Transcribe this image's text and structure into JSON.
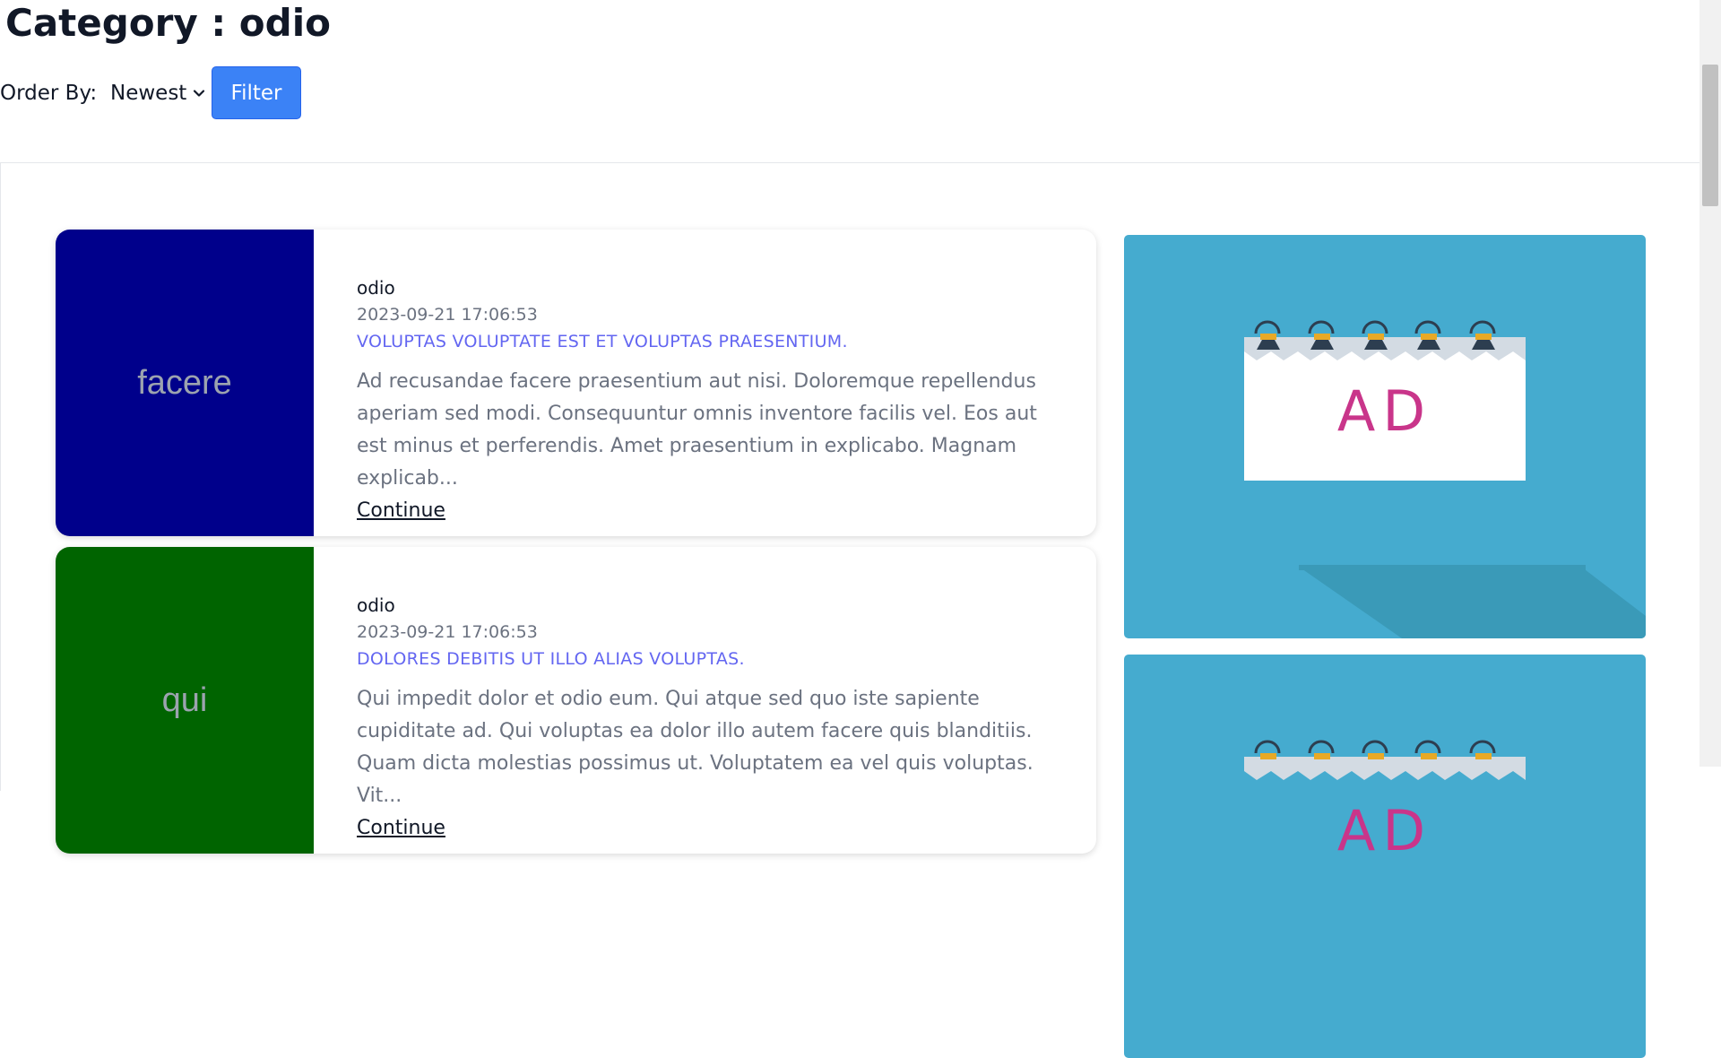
{
  "page": {
    "title": "Category : odio"
  },
  "filter": {
    "order_label": "Order By:",
    "order_value": "Newest",
    "button_label": "Filter"
  },
  "posts": [
    {
      "thumb_text": "facere",
      "thumb_color": "#00008b",
      "category": "odio",
      "date": "2023-09-21 17:06:53",
      "title": "Voluptas voluptate est et voluptas praesentium.",
      "excerpt": "Ad recusandae facere praesentium aut nisi. Doloremque repellendus aperiam sed modi. Consequuntur omnis inventore facilis vel. Eos aut est minus et perferendis. Amet praesentium in explicabo. Magnam explicab...",
      "continue_label": "Continue"
    },
    {
      "thumb_text": "qui",
      "thumb_color": "#006400",
      "category": "odio",
      "date": "2023-09-21 17:06:53",
      "title": "Dolores debitis ut illo alias voluptas.",
      "excerpt": "Qui impedit dolor et odio eum. Qui atque sed quo iste sapiente cupiditate ad. Qui voluptas ea dolor illo autem facere quis blanditiis. Quam dicta molestias possimus ut. Voluptatem ea vel quis voluptas. Vit...",
      "continue_label": "Continue"
    }
  ],
  "ads": [
    {
      "text": "AD",
      "background": "#45abcf"
    },
    {
      "text": "AD",
      "background": "#45abcf"
    }
  ]
}
